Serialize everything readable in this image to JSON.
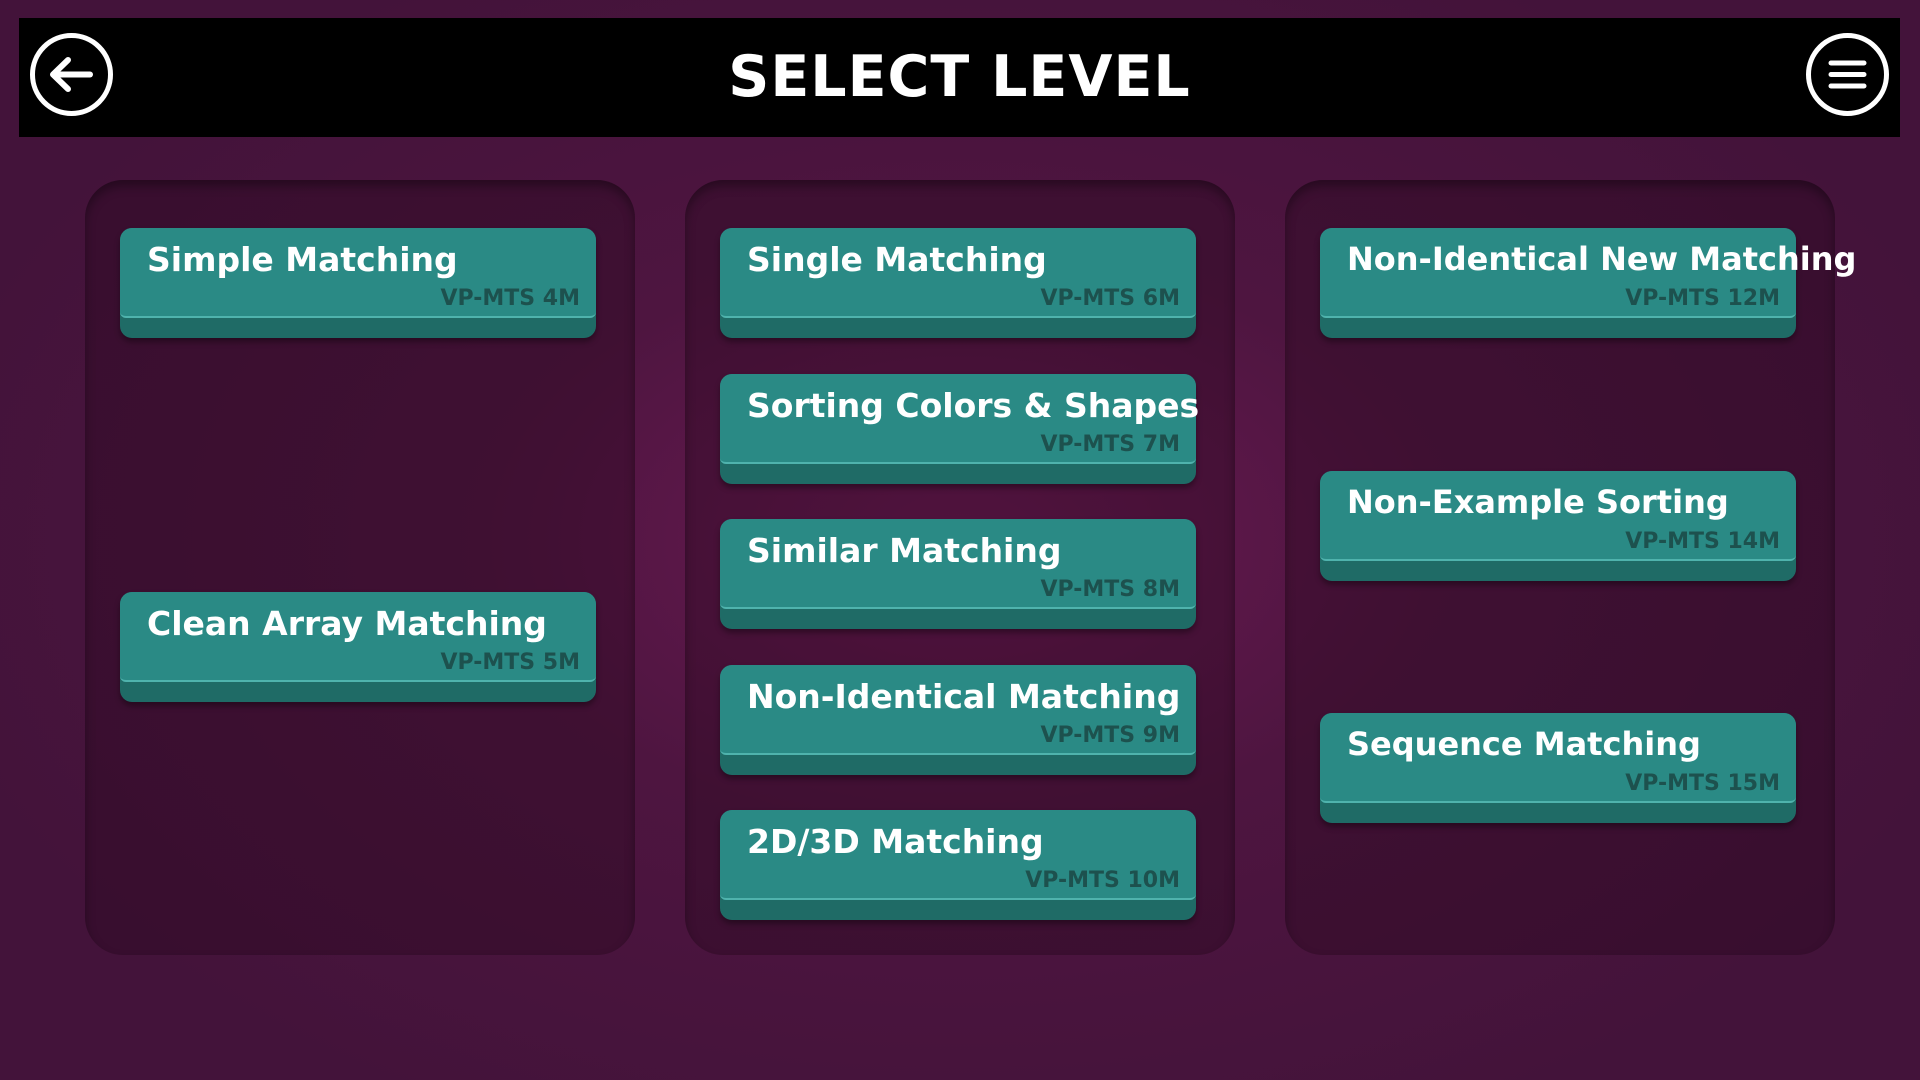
{
  "header": {
    "title": "SELECT LEVEL",
    "back_icon": "back-arrow-icon",
    "menu_icon": "hamburger-menu-icon"
  },
  "colors": {
    "background": "#4e1540",
    "header": "#000000",
    "button_face": "#2a8a85",
    "button_shadow": "#1f6b66",
    "code_text": "#1d514e"
  },
  "columns": [
    {
      "levels": [
        {
          "name": "Simple Matching",
          "code": "VP-MTS 4M"
        },
        {
          "name": "Clean Array Matching",
          "code": "VP-MTS 5M"
        }
      ]
    },
    {
      "levels": [
        {
          "name": "Single Matching",
          "code": "VP-MTS 6M"
        },
        {
          "name": "Sorting Colors & Shapes",
          "code": "VP-MTS 7M"
        },
        {
          "name": "Similar Matching",
          "code": "VP-MTS 8M"
        },
        {
          "name": "Non-Identical Matching",
          "code": "VP-MTS 9M"
        },
        {
          "name": "2D/3D Matching",
          "code": "VP-MTS 10M"
        }
      ]
    },
    {
      "levels": [
        {
          "name": "Non-Identical New Matching",
          "code": "VP-MTS 12M"
        },
        {
          "name": "Non-Example Sorting",
          "code": "VP-MTS 14M"
        },
        {
          "name": "Sequence Matching",
          "code": "VP-MTS 15M"
        }
      ]
    }
  ]
}
